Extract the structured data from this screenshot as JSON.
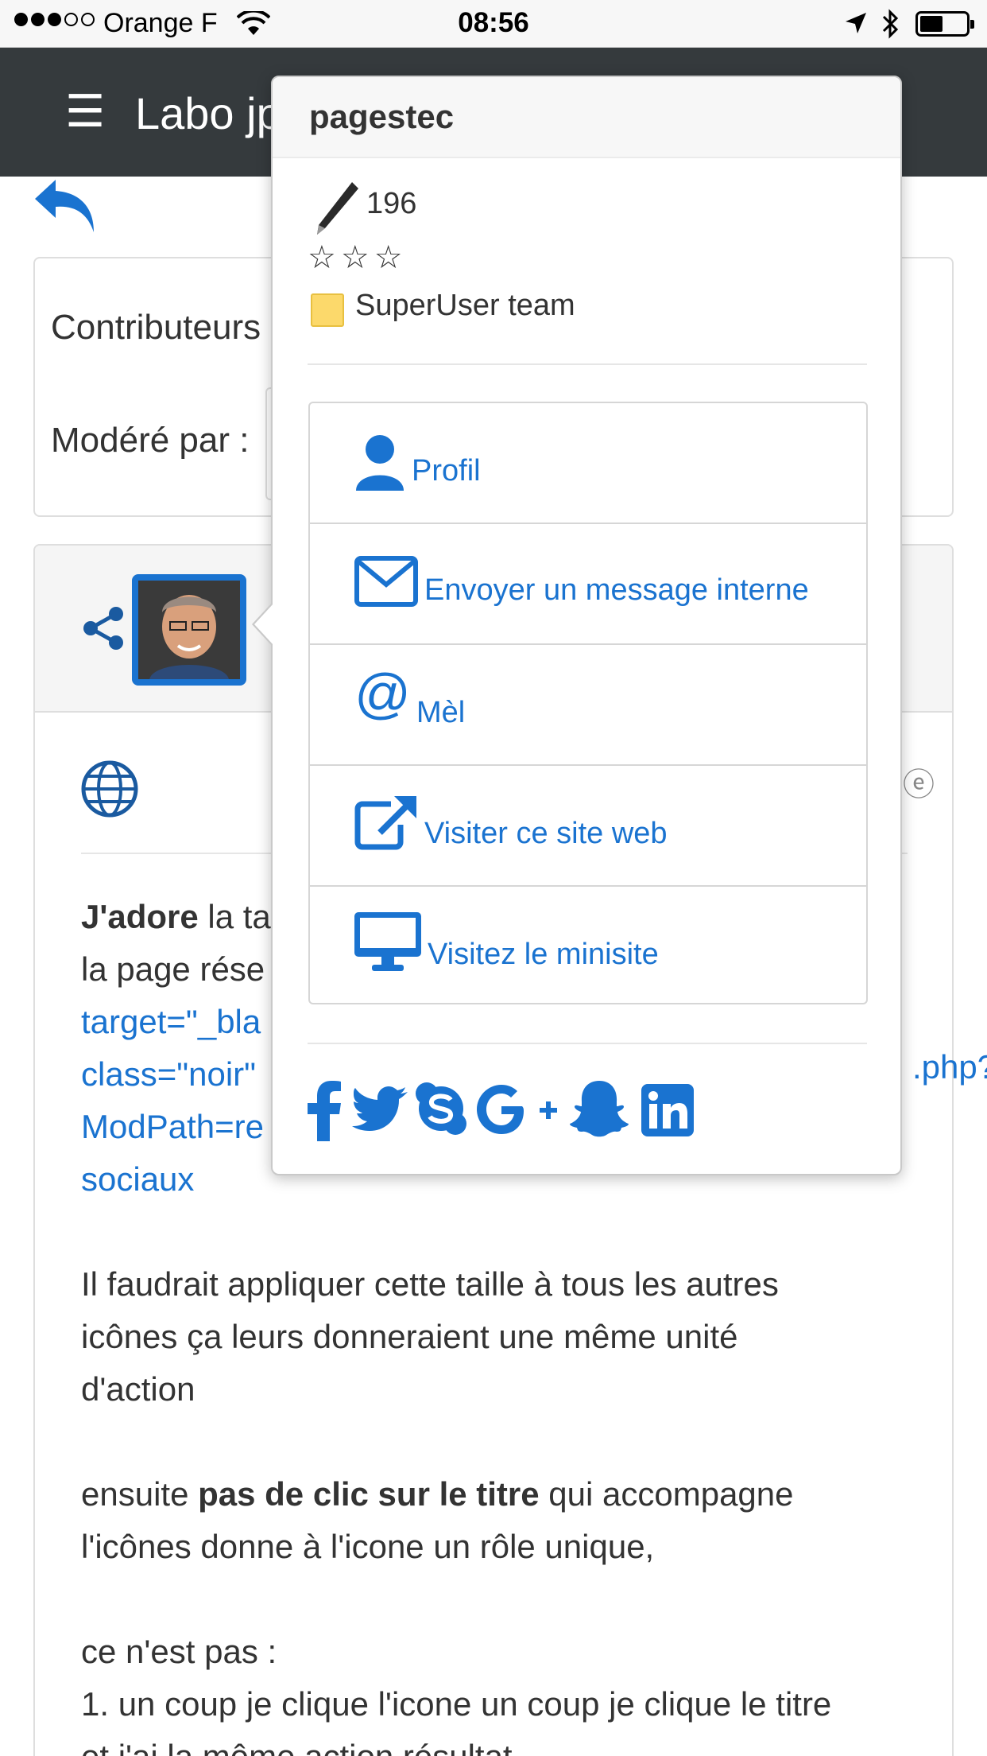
{
  "status_bar": {
    "carrier": "Orange F",
    "time": "08:56"
  },
  "navbar": {
    "menu_glyph": "☰",
    "title": "Labo jp"
  },
  "card_info": {
    "contributors_label": "Contributeurs",
    "moderated_label": "Modéré par :"
  },
  "post": {
    "edge_glyph": "ⓔ",
    "lines": {
      "l1_bold": "J'adore",
      "l1_rest": " la ta",
      "l2": "la page rése",
      "l3": "target=\"_bla",
      "l4": "class=\"noir\"",
      "l4_edge": ".php?",
      "l5": "ModPath=re",
      "l6": "sociaux",
      "p2_l1": "Il faudrait appliquer cette taille à tous les autres",
      "p2_l2": "icônes ça leurs donneraient une même unité",
      "p2_l3": "d'action",
      "p3_l1_a": "ensuite ",
      "p3_l1_bold": "pas de clic sur le titre",
      "p3_l1_b": " qui accompagne",
      "p3_l2": "l'icônes donne à l'icone un rôle unique,",
      "p4_l1": "ce n'est pas :",
      "p4_l2": "1. un coup je clique l'icone un coup je clique le titre",
      "p4_l3": "et j'ai la même action résultat"
    }
  },
  "popover": {
    "username": "pagestec",
    "post_count": "196",
    "stars": [
      "☆",
      "☆",
      "☆"
    ],
    "team": "SuperUser team",
    "menu": [
      {
        "label": "Profil",
        "icon": "user-icon"
      },
      {
        "label": "Envoyer un message interne",
        "icon": "envelope-icon"
      },
      {
        "label": "Mèl",
        "icon": "at-icon"
      },
      {
        "label": "Visiter ce site web",
        "icon": "external-link-icon"
      },
      {
        "label": "Visitez le minisite",
        "icon": "desktop-icon"
      }
    ],
    "socials": [
      "facebook-icon",
      "twitter-icon",
      "skype-icon",
      "google-plus-icon",
      "snapchat-icon",
      "linkedin-icon"
    ]
  },
  "colors": {
    "accent": "#1a73d0",
    "navbar": "#353a3d"
  }
}
